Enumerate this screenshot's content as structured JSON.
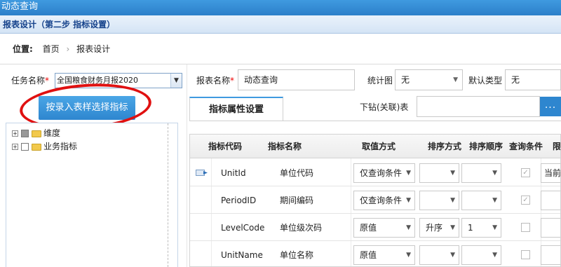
{
  "window": {
    "title": "动态查询"
  },
  "subheader": {
    "title": "报表设计（第二步 指标设置）"
  },
  "breadcrumb": {
    "label": "位置:",
    "items": [
      "首页",
      "报表设计"
    ],
    "separator": "›"
  },
  "left": {
    "task_label": "任务名称",
    "task_value": "全国粮食财务月报2020",
    "pick_button": "按录入表样选择指标",
    "tree": [
      {
        "label": "维度",
        "state": "partial"
      },
      {
        "label": "业务指标",
        "state": "unchecked"
      }
    ]
  },
  "form": {
    "report_name_label": "报表名称",
    "report_name_value": "动态查询",
    "chart_label": "统计图",
    "chart_value": "无",
    "default_type_label": "默认类型",
    "default_type_value": "无",
    "drill_label": "下钻(关联)表",
    "drill_value": "",
    "drill_button": "...",
    "required_mark": "*"
  },
  "tabs": [
    {
      "label": "指标属性设置",
      "active": true
    }
  ],
  "grid": {
    "columns": [
      "指标代码",
      "指标名称",
      "取值方式",
      "排序方式",
      "排序顺序",
      "查询条件",
      "限定"
    ],
    "rows": [
      {
        "code": "UnitId",
        "name": "单位代码",
        "value_mode": "仅查询条件",
        "sort_mode": "",
        "sort_order": "",
        "query": true,
        "limit": "当前",
        "current": true
      },
      {
        "code": "PeriodID",
        "name": "期间编码",
        "value_mode": "仅查询条件",
        "sort_mode": "",
        "sort_order": "",
        "query": true,
        "limit": "",
        "current": false
      },
      {
        "code": "LevelCode",
        "name": "单位级次码",
        "value_mode": "原值",
        "sort_mode": "升序",
        "sort_order": "1",
        "query": false,
        "limit": "",
        "current": false
      },
      {
        "code": "UnitName",
        "name": "单位名称",
        "value_mode": "原值",
        "sort_mode": "",
        "sort_order": "",
        "query": false,
        "limit": "",
        "current": false
      }
    ]
  },
  "colors": {
    "title_bar": "#3f9ae0",
    "accent": "#2e86cf",
    "annotation": "#e01010",
    "required": "#ee0000"
  }
}
